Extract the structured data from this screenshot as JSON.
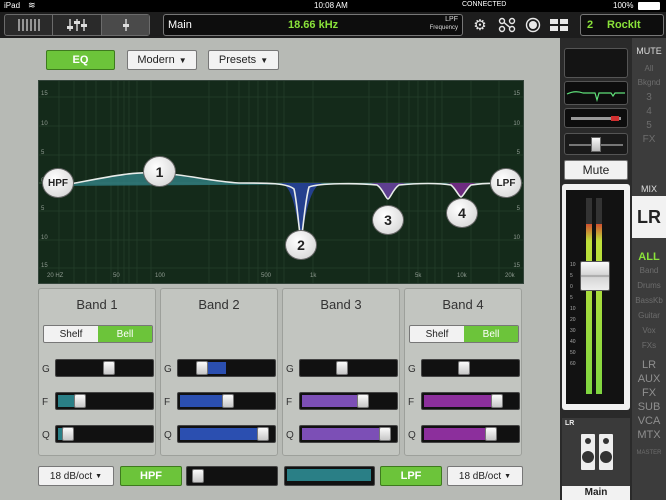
{
  "status_bar": {
    "device": "iPad",
    "time": "10:08 AM",
    "connection": "CONNECTED",
    "battery": "100%"
  },
  "toolbar": {
    "view_icons": [
      "channel-strip-icon",
      "mixer-sliders-icon",
      "single-fader-icon"
    ],
    "channel_name": "Main",
    "param_value": "18.66 kHz",
    "param_name_line1": "LPF",
    "param_name_line2": "Frequency",
    "snapshot_number": "2",
    "snapshot_name": "RockIt"
  },
  "eq_controls": {
    "eq_label": "EQ",
    "mode_label": "Modern",
    "presets_label": "Presets"
  },
  "graph": {
    "db_ticks": [
      "15",
      "10",
      "5",
      "0",
      "5",
      "10",
      "15"
    ],
    "freq_ticks": [
      "20 HZ",
      "50",
      "100",
      "500",
      "1k",
      "5k",
      "10k",
      "20k"
    ],
    "nodes": [
      "HPF",
      "1",
      "2",
      "3",
      "4",
      "LPF"
    ]
  },
  "bands": [
    {
      "title": "Band 1",
      "shelf": "Shelf",
      "bell": "Bell",
      "shape": "bell",
      "g": "G",
      "f": "F",
      "q": "Q",
      "gain": 0.55,
      "freq": 0.2,
      "q_value": 0.05,
      "color": "#2a7f86"
    },
    {
      "title": "Band 2",
      "shelf": "",
      "bell": "",
      "shape": "",
      "g": "G",
      "f": "F",
      "q": "Q",
      "gain": 0.2,
      "freq": 0.52,
      "q_value": 0.95,
      "color": "#2b4fb0"
    },
    {
      "title": "Band 3",
      "shelf": "",
      "bell": "",
      "shape": "",
      "g": "G",
      "f": "F",
      "q": "Q",
      "gain": 0.42,
      "freq": 0.68,
      "q_value": 0.95,
      "color": "#7c4fb6"
    },
    {
      "title": "Band 4",
      "shelf": "Shelf",
      "bell": "Bell",
      "shape": "bell",
      "g": "G",
      "f": "F",
      "q": "Q",
      "gain": 0.42,
      "freq": 0.83,
      "q_value": 0.75,
      "color": "#8c2f9c"
    }
  ],
  "filters": {
    "hpf_slope": "18 dB/oct",
    "hpf_label": "HPF",
    "hpf_freq": 0.04,
    "lpf_label": "LPF",
    "lpf_slope": "18 dB/oct",
    "lpf_freq": 0.98
  },
  "right_panel": {
    "mute_header": "MUTE",
    "mute_groups": [
      "All",
      "Bkgnd",
      "3",
      "4",
      "5",
      "FX"
    ],
    "mute_label": "Mute",
    "mix_header": "MIX",
    "mix_current": "LR",
    "mix_filters": [
      "ALL",
      "Band",
      "Drums",
      "BassKb",
      "Guitar",
      "Vox",
      "FXs"
    ],
    "mix_tabs": [
      "LR",
      "AUX",
      "FX",
      "SUB",
      "VCA",
      "MTX"
    ],
    "master_label": "MASTER",
    "channel_tag": "LR",
    "channel_name": "Main",
    "meter_scale": [
      "10",
      "5",
      "0",
      "5",
      "10",
      "20",
      "30",
      "40",
      "50",
      "60"
    ],
    "fader_level": 0.62
  }
}
